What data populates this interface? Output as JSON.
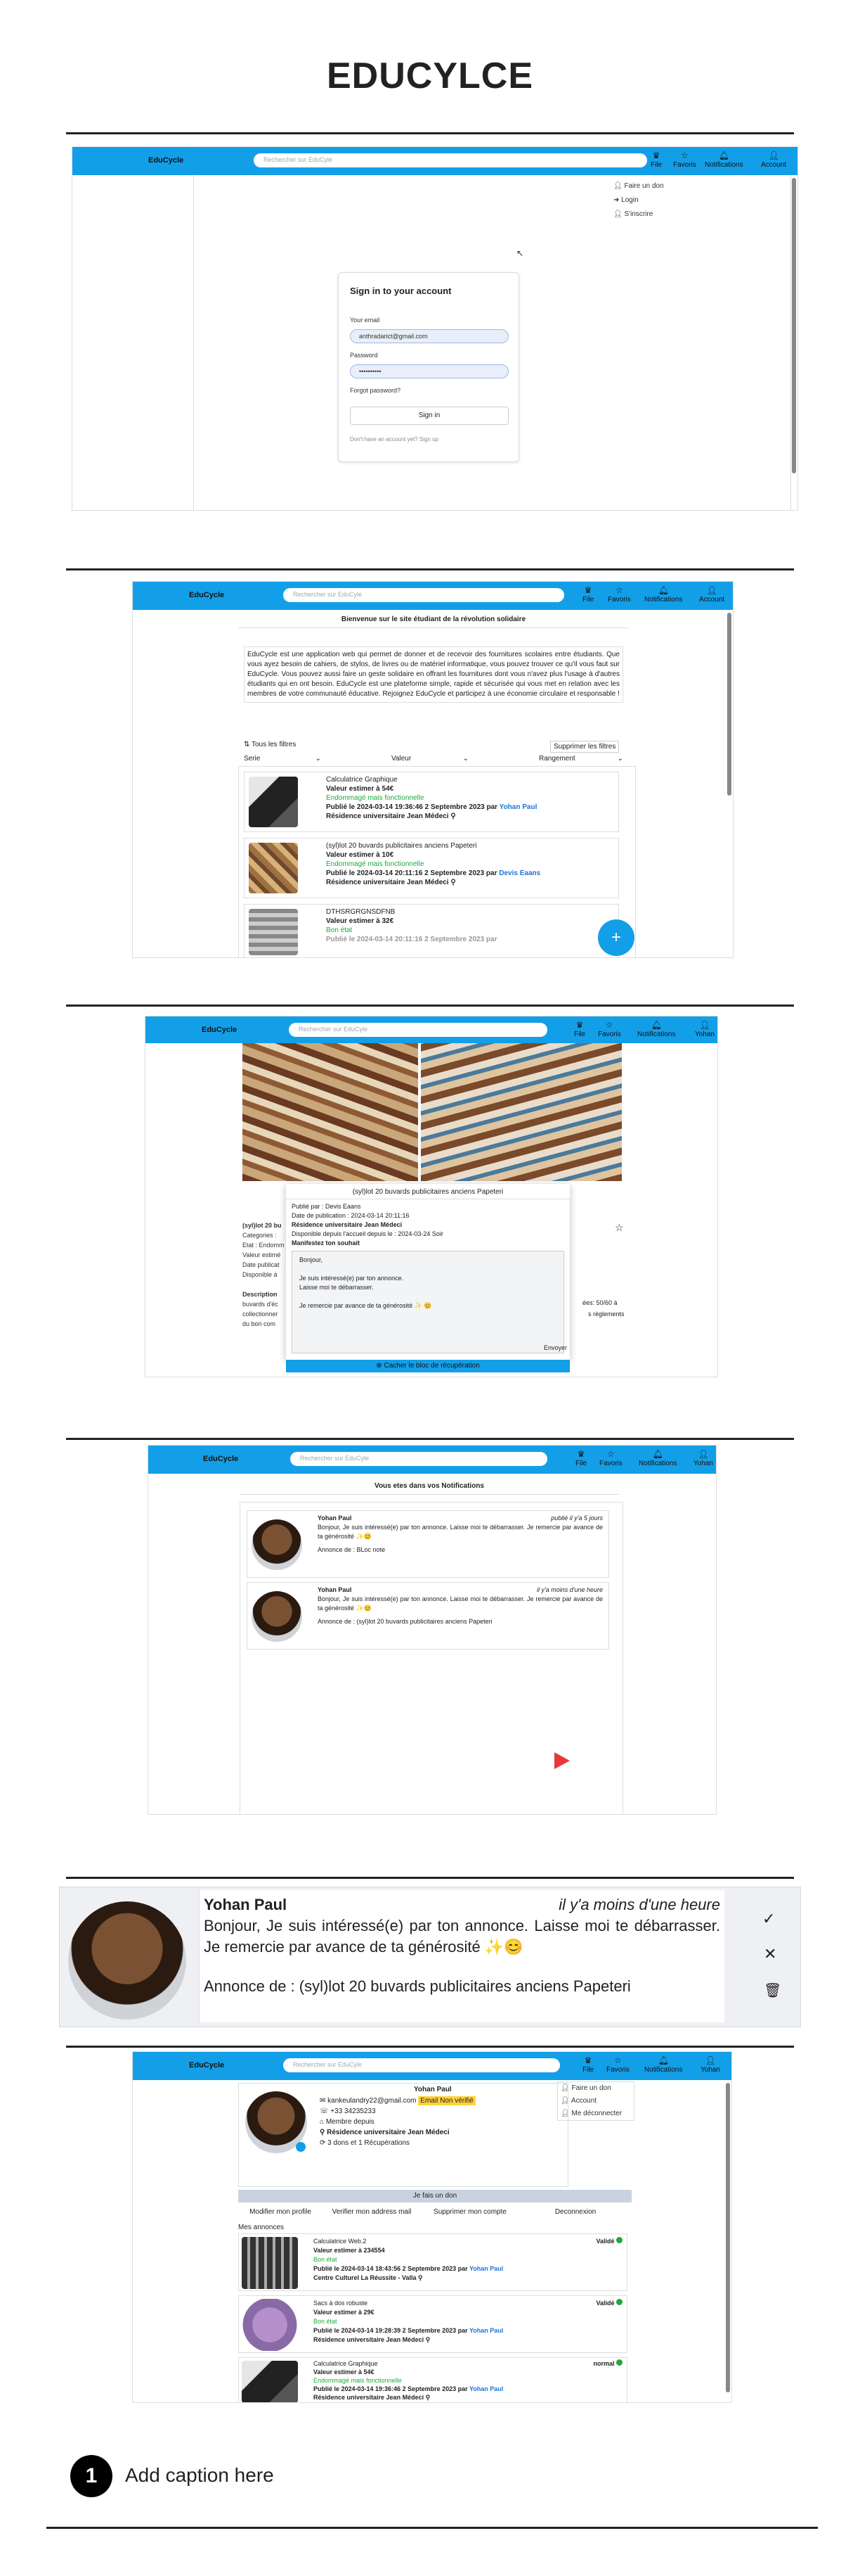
{
  "page_title": "EDUCYLCE",
  "caption": {
    "number": "1",
    "text": "Add caption here"
  },
  "app": {
    "logo": "EduCycle",
    "search_placeholder": "Rechercher sur EduCyle",
    "nav": {
      "file": "File",
      "favoris": "Favoris",
      "notifications": "Notifications",
      "account": "Account",
      "user": "Yohan"
    }
  },
  "screen1": {
    "dropdown": [
      "Faire un don",
      "Login",
      "S'inscrire"
    ],
    "signin_title": "Sign in to your account",
    "email_label": "Your email",
    "email_value": "anthradarict@gmail.com",
    "password_label": "Password",
    "password_value": "••••••••••",
    "forgot": "Forgot password?",
    "button": "Sign in",
    "no_account": "Don't have an account yet? Sign up"
  },
  "screen2": {
    "welcome": "Bienvenue sur le site étudiant de la révolution solidaire",
    "intro": "EduCycle est une application web qui permet de donner et de recevoir des fournitures scolaires entre étudiants. Que vous ayez besoin de cahiers, de stylos, de livres ou de matériel informatique, vous pouvez trouver ce qu'il vous faut sur EduCycle. Vous pouvez aussi faire un geste solidaire en offrant les fournitures dont vous n'avez plus l'usage à d'autres étudiants qui en ont besoin. EduCycle est une plateforme simple, rapide et sécurisée qui vous met en relation avec les membres de votre communauté éducative. Rejoignez EduCycle et participez à une économie circulaire et responsable !",
    "all_filters": "Tous les filtres",
    "remove_filters": "Supprimer les filtres",
    "filters": [
      "Serie",
      "Valeur",
      "Rangement"
    ],
    "items": [
      {
        "title": "Calculatrice Graphique",
        "value": "Valeur estimer à 54€",
        "state": "Endommagé mais fonctionnelle",
        "pub": "Publié le 2024-03-14 19:36:46 2 Septembre 2023 par ",
        "author": "Yohan Paul",
        "res": "Résidence universitaire Jean Médeci"
      },
      {
        "title": "(syl)lot 20 buvards publicitaires anciens Papeteri",
        "value": "Valeur estimer à 10€",
        "state": "Endommagé mais fonctionnelle",
        "pub": "Publié le 2024-03-14 20:11:16 2 Septembre 2023 par ",
        "author": "Devis Eaans",
        "res": "Résidence universitaire Jean Médeci"
      },
      {
        "title": "DTHSRGRGNSDFNB",
        "value": "Valeur estimer à 32€",
        "state": "Bon état",
        "pub": "Publié le 2024-03-14 20:11:16 2 Septembre 2023 par ",
        "author": "",
        "res": ""
      }
    ],
    "fab": "+"
  },
  "screen3": {
    "modal_title": "(syl)lot 20 buvards publicitaires anciens Papeteri",
    "published_by": "Publié par : Devis Eaans",
    "pub_date": "Date de publication : 2024-03-14 20:11:16",
    "residence": "Résidence universitaire Jean Médeci",
    "available": "Disponible depuis l'accueil depuis le : 2024-03-24 Soir",
    "wish": "Manifestez ton souhait",
    "message": [
      "Bonjour,",
      "Je suis intéressé(e) par ton annonce.",
      "Laisse moi te débarrasser.",
      "Je remercie par avance de ta générosité ✨ 😊"
    ],
    "send": "Envoyer",
    "counter": "ées: 50/60 à",
    "rules": "s règlements",
    "hide": "Cacher le bloc de récupération",
    "side_title": "(syl)lot 20 bu",
    "side_lines": [
      "Categories :",
      "Etat : Endomm",
      "Valeur estimé",
      "Date publicat",
      "Disponible à"
    ],
    "desc_title": "Description",
    "desc_lines": [
      "buvards d'éc",
      "collectionner",
      "du bon com"
    ]
  },
  "screen4": {
    "heading": "Vous etes dans vos Notifications",
    "notifs": [
      {
        "name": "Yohan Paul",
        "time": "publié il y'a 5 jours",
        "msg": "Bonjour, Je suis intéressé(e) par ton annonce. Laisse moi te débarrasser. Je remercie par avance de ta générosité ✨😊",
        "annonce": "Annonce de : BLoc note"
      },
      {
        "name": "Yohan Paul",
        "time": "il y'a moins d'une heure",
        "msg": "Bonjour, Je suis intéressé(e) par ton annonce. Laisse moi te débarrasser. Je remercie par avance de ta générosité ✨😊",
        "annonce": "Annonce de : (syl)lot 20 buvards publicitaires anciens Papeteri"
      }
    ]
  },
  "zoom": {
    "name": "Yohan Paul",
    "time": "il y'a moins d'une heure",
    "msg": "Bonjour, Je suis intéressé(e) par ton annonce. Laisse moi te débarrasser. Je remercie par avance de ta générosité ✨😊",
    "annonce": "Annonce de : (syl)lot 20 buvards publicitaires anciens Papeteri"
  },
  "screen6": {
    "dropdown": [
      "Faire un don",
      "Account",
      "Me déconnecter"
    ],
    "name": "Yohan Paul",
    "email": "kankeulandry22@gmail.com",
    "badge": "Email Non vérifié",
    "phone": "+33 34235233",
    "member": "Membre depuis",
    "residence": "Résidence universitaire Jean Médeci",
    "stats": "3 dons et 1 Récupérations",
    "make_donation": "Je fais un don",
    "actions": [
      "Modifier mon profile",
      "Verifier mon address mail",
      "Supprimer mon compte",
      "Deconnexion"
    ],
    "my_ads": "Mes annonces",
    "ads": [
      {
        "title": "Calculatrice Web.2",
        "status": "Validé",
        "value": "Valeur estimer à 234554",
        "state": "Bon état",
        "pub": "Publié le 2024-03-14 18:43:56 2 Septembre 2023 par ",
        "author": "Yohan Paul",
        "res": "Centre Culturel La Réussite - Valla"
      },
      {
        "title": "Sacs à dos robuste",
        "status": "Validé",
        "value": "Valeur estimer à 29€",
        "state": "Bon état",
        "pub": "Publié le 2024-03-14 19:28:39 2 Septembre 2023 par ",
        "author": "Yohan Paul",
        "res": "Résidence universitaire Jean Médeci"
      },
      {
        "title": "Calculatrice Graphique",
        "status": "normal",
        "value": "Valeur estimer à 54€",
        "state": "Endommagé mais fonctionnelle",
        "pub": "Publié le 2024-03-14 19:36:46 2 Septembre 2023 par ",
        "author": "Yohan Paul",
        "res": "Résidence universitaire Jean Médeci"
      }
    ]
  }
}
